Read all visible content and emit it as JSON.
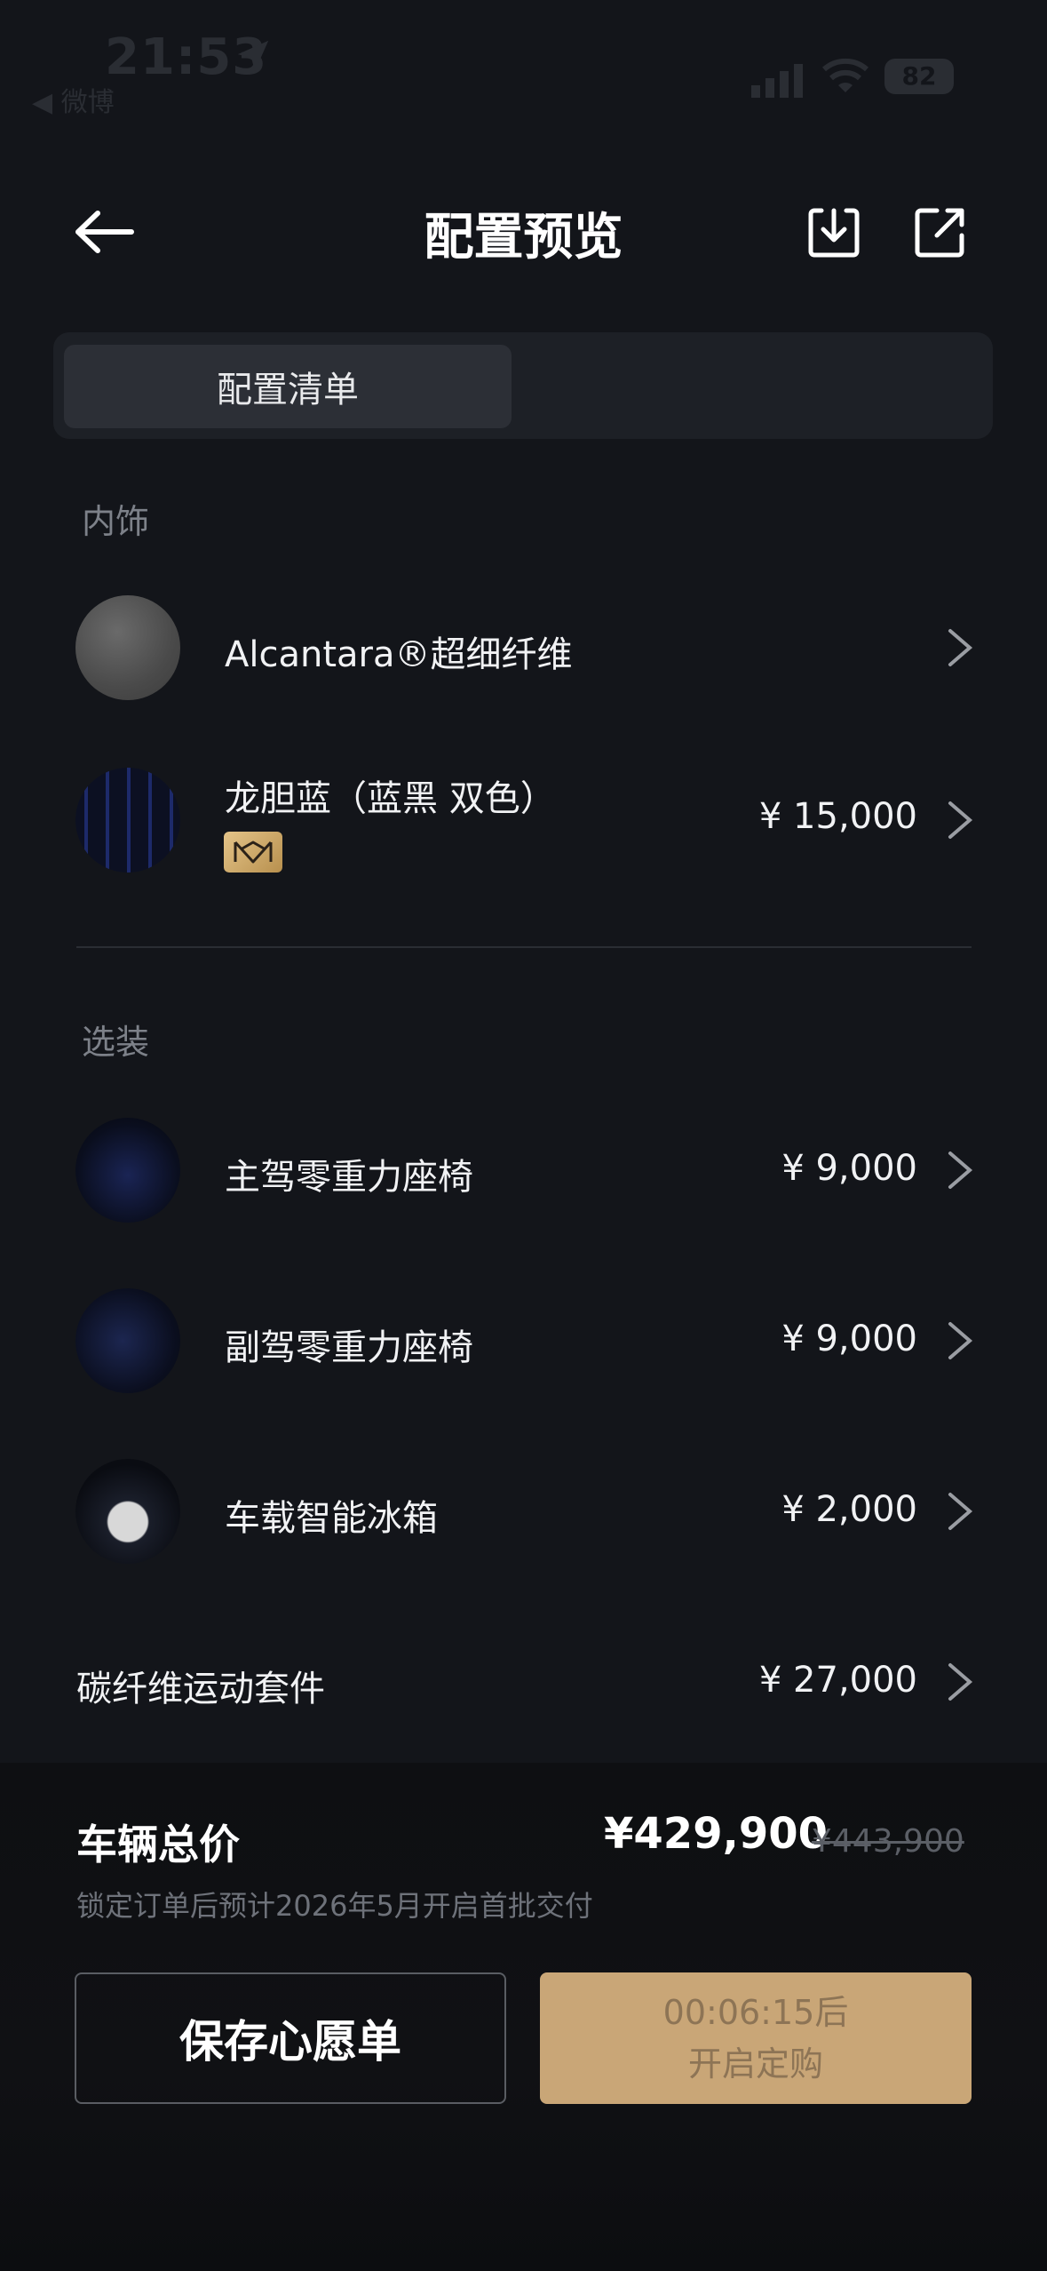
{
  "status_bar": {
    "time": "21:53",
    "back_app": "◀ 微博",
    "battery": "82"
  },
  "header": {
    "title": "配置预览"
  },
  "tabs": {
    "active_label": "配置清单"
  },
  "interior": {
    "section_label": "内饰",
    "items": [
      {
        "label": "Alcantara®超细纤维",
        "price": ""
      },
      {
        "label": "龙胆蓝（蓝黑 双色）",
        "price": "¥ 15,000"
      }
    ]
  },
  "options": {
    "section_label": "选装",
    "items": [
      {
        "label": "主驾零重力座椅",
        "price": "¥ 9,000"
      },
      {
        "label": "副驾零重力座椅",
        "price": "¥ 9,000"
      },
      {
        "label": "车载智能冰箱",
        "price": "¥ 2,000"
      },
      {
        "label": "碳纤维运动套件",
        "price": "¥ 27,000"
      }
    ]
  },
  "summary": {
    "total_label": "车辆总价",
    "total_price": "¥429,900",
    "original_price": "¥443,900",
    "delivery_note": "锁定订单后预计2026年5月开启首批交付"
  },
  "actions": {
    "wishlist_label": "保存心愿单",
    "order_countdown": "00:06:15后",
    "order_label": "开启定购"
  },
  "colors": {
    "background": "#13151a",
    "accent_gold": "#c9a677",
    "badge_gold": "#e4c489"
  }
}
